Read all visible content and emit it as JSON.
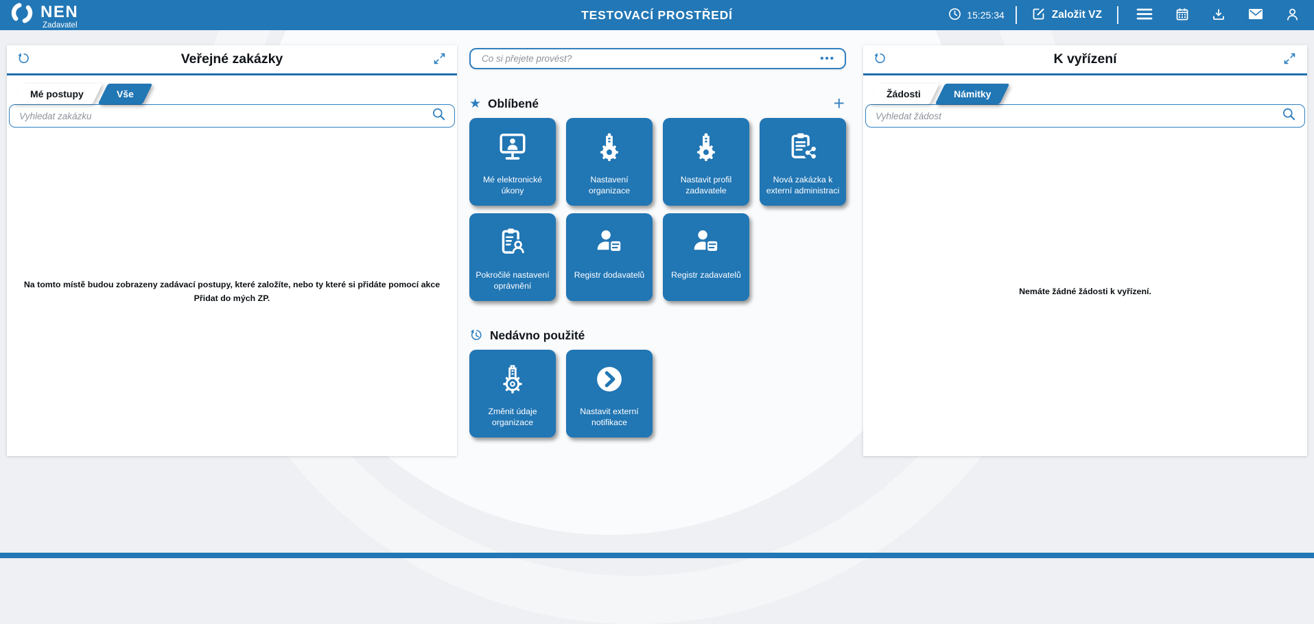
{
  "topbar": {
    "logo_text": "NEN",
    "logo_subtitle": "Zadavatel",
    "title": "TESTOVACÍ PROSTŘEDÍ",
    "time": "15:25:34",
    "create_button": "Založit VZ",
    "icon_buttons": [
      "menu-icon",
      "calendar-icon",
      "download-icon",
      "mail-icon",
      "user-icon"
    ]
  },
  "left_panel": {
    "title": "Veřejné zakázky",
    "tabs": [
      {
        "label": "Mé postupy",
        "active": false
      },
      {
        "label": "Vše",
        "active": true
      }
    ],
    "search_placeholder": "Vyhledat zakázku",
    "empty_text": "Na tomto místě budou zobrazeny zadávací postupy, které založíte, nebo ty které si přidáte pomocí akce Přidat do mých ZP."
  },
  "center": {
    "command_placeholder": "Co si přejete provést?",
    "more_label": "•••",
    "favorites": {
      "title": "Oblíbené",
      "icon": "star-icon",
      "add_label": "+",
      "tiles": [
        {
          "label": "Mé elektronické úkony",
          "icon": "monitor-user-icon"
        },
        {
          "label": "Nastavení organizace",
          "icon": "gear-building-icon"
        },
        {
          "label": "Nastavit profil zadavatele",
          "icon": "gear-building-icon"
        },
        {
          "label": "Nová zakázka k externí administraci",
          "icon": "clipboard-share-icon"
        },
        {
          "label": "Pokročilé nastavení oprávnění",
          "icon": "clipboard-user-icon"
        },
        {
          "label": "Registr dodavatelů",
          "icon": "user-document-icon"
        },
        {
          "label": "Registr zadavatelů",
          "icon": "user-document-icon"
        }
      ]
    },
    "recent": {
      "title": "Nedávno použité",
      "icon": "history-icon",
      "tiles": [
        {
          "label": "Změnit údaje organizace",
          "icon": "gear-building-outline-icon"
        },
        {
          "label": "Nastavit externí notifikace",
          "icon": "arrow-circle-icon"
        }
      ]
    }
  },
  "right_panel": {
    "title": "K vyřízení",
    "tabs": [
      {
        "label": "Žádosti",
        "active": false
      },
      {
        "label": "Námitky",
        "active": true
      }
    ],
    "search_placeholder": "Vyhledat žádost",
    "empty_text": "Nemáte žádné žádosti k vyřízení."
  },
  "colors": {
    "topbar_blue": "#2277b6",
    "tile_blue": "#2176b4",
    "underline_blue": "#1d6fad",
    "icon_blue": "#2e7fc0",
    "page_bg": "#eef0f3",
    "panel_bg": "#ffffff"
  }
}
